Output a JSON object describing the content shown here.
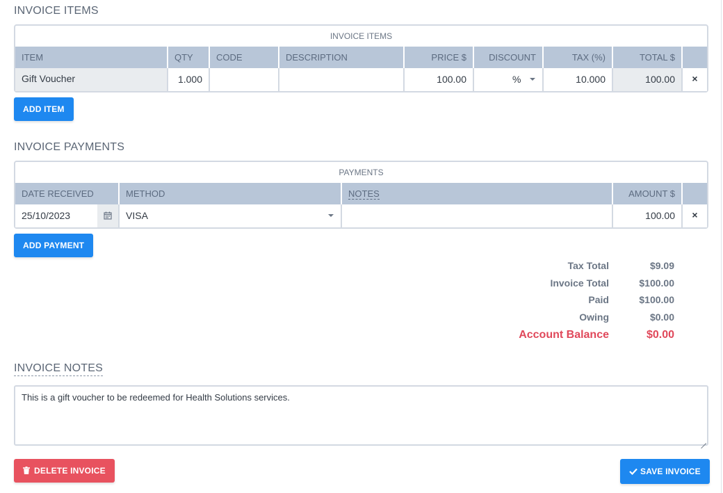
{
  "items_section": {
    "title": "INVOICE ITEMS",
    "caption": "INVOICE ITEMS",
    "headers": [
      "ITEM",
      "QTY",
      "CODE",
      "DESCRIPTION",
      "PRICE $",
      "DISCOUNT",
      "TAX (%)",
      "TOTAL $"
    ],
    "rows": [
      {
        "item": "Gift Voucher",
        "qty": "1.000",
        "code": "",
        "description": "",
        "price": "100.00",
        "discount": "%",
        "tax": "10.000",
        "total": "100.00",
        "delete": "×"
      }
    ],
    "add_label": "ADD ITEM"
  },
  "payments_section": {
    "title": "INVOICE PAYMENTS",
    "caption": "PAYMENTS",
    "headers": [
      "DATE RECEIVED",
      "METHOD",
      "NOTES",
      "AMOUNT $"
    ],
    "rows": [
      {
        "date": "25/10/2023",
        "method": "VISA",
        "notes": "",
        "amount": "100.00",
        "delete": "×"
      }
    ],
    "add_label": "ADD PAYMENT"
  },
  "totals": {
    "tax_total_label": "Tax Total",
    "tax_total": "$9.09",
    "invoice_total_label": "Invoice Total",
    "invoice_total": "$100.00",
    "paid_label": "Paid",
    "paid": "$100.00",
    "owing_label": "Owing",
    "owing": "$0.00",
    "balance_label": "Account Balance",
    "balance": "$0.00"
  },
  "notes_section": {
    "title": "INVOICE NOTES",
    "value": "This is a gift voucher to be redeemed for Health Solutions services."
  },
  "actions": {
    "delete_label": "DELETE INVOICE",
    "save_label": "SAVE INVOICE"
  },
  "colors": {
    "primary": "#1e88f0",
    "danger": "#e8525f",
    "header_bg": "#b8c6d8",
    "balance": "#e0485a"
  }
}
